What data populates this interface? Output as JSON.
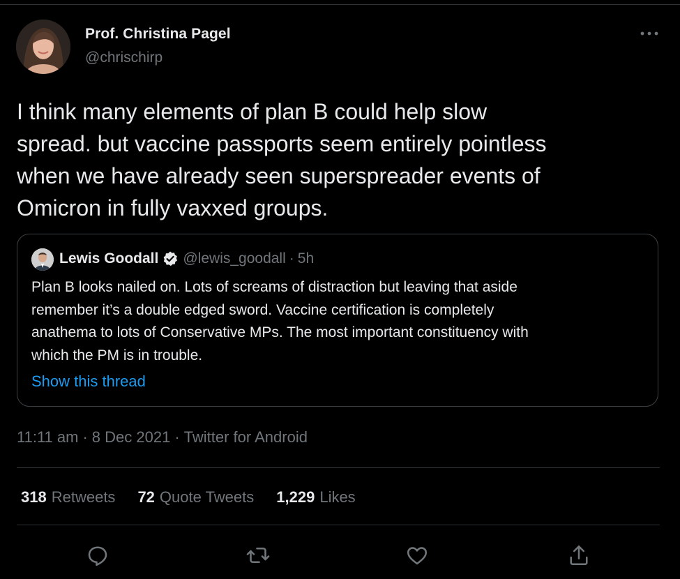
{
  "tweet": {
    "author": {
      "name": "Prof. Christina Pagel",
      "handle": "@chrischirp"
    },
    "text": "I think many elements of plan B could help slow\nspread. but vaccine passports seem entirely pointless\nwhen we have already seen superspreader events of\nOmicron in fully vaxxed groups.",
    "quoted": {
      "name": "Lewis Goodall",
      "handle": "@lewis_goodall",
      "dot": "·",
      "time": "5h",
      "text": "Plan B looks nailed on. Lots of screams of distraction but leaving that aside\nremember it’s a double edged sword. Vaccine certification is completely\nanathema to lots of Conservative MPs.  The most important constituency with\nwhich the PM is in trouble.",
      "show_thread": "Show this thread"
    },
    "meta": {
      "time": "11:11 am",
      "sep1": "·",
      "date": "8 Dec 2021",
      "sep2": "·",
      "source": "Twitter for Android"
    },
    "stats": {
      "retweets_count": "318",
      "retweets_label": "Retweets",
      "quotes_count": "72",
      "quotes_label": "Quote Tweets",
      "likes_count": "1,229",
      "likes_label": "Likes"
    }
  },
  "icons": {
    "more": "more-horizontal-icon",
    "reply": "reply-icon",
    "retweet": "retweet-icon",
    "like": "heart-icon",
    "share": "share-icon",
    "verified": "verified-badge-icon"
  },
  "colors": {
    "background": "#000000",
    "text": "#e7e9ea",
    "secondary": "#71767b",
    "link": "#1d9bf0",
    "border": "#2f3336"
  }
}
